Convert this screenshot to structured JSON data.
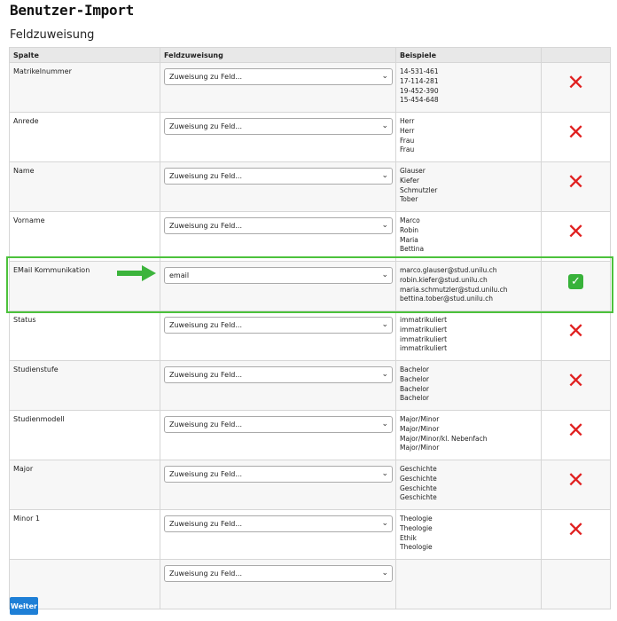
{
  "page": {
    "title": "Benutzer-Import",
    "section_title": "Feldzuweisung"
  },
  "table": {
    "headers": [
      "Spalte",
      "Feldzuweisung",
      "Beispiele",
      ""
    ],
    "rows": [
      {
        "column": "Matrikelnummer",
        "assignment": "Zuweisung zu Feld...",
        "examples": [
          "14-531-461",
          "17-114-281",
          "19-452-390",
          "15-454-648"
        ],
        "status": "invalid"
      },
      {
        "column": "Anrede",
        "assignment": "Zuweisung zu Feld...",
        "examples": [
          "Herr",
          "Herr",
          "Frau",
          "Frau"
        ],
        "status": "invalid"
      },
      {
        "column": "Name",
        "assignment": "Zuweisung zu Feld...",
        "examples": [
          "Glauser",
          "Kiefer",
          "Schmutzler",
          "Tober"
        ],
        "status": "invalid"
      },
      {
        "column": "Vorname",
        "assignment": "Zuweisung zu Feld...",
        "examples": [
          "Marco",
          "Robin",
          "Maria",
          "Bettina"
        ],
        "status": "invalid"
      },
      {
        "column": "EMail Kommunikation",
        "assignment": "email",
        "examples": [
          "marco.glauser@stud.unilu.ch",
          "robin.kiefer@stud.unilu.ch",
          "maria.schmutzler@stud.unilu.ch",
          "bettina.tober@stud.unilu.ch"
        ],
        "status": "valid"
      },
      {
        "column": "Status",
        "assignment": "Zuweisung zu Feld...",
        "examples": [
          "immatrikuliert",
          "immatrikuliert",
          "immatrikuliert",
          "immatrikuliert"
        ],
        "status": "invalid"
      },
      {
        "column": "Studienstufe",
        "assignment": "Zuweisung zu Feld...",
        "examples": [
          "Bachelor",
          "Bachelor",
          "Bachelor",
          "Bachelor"
        ],
        "status": "invalid"
      },
      {
        "column": "Studienmodell",
        "assignment": "Zuweisung zu Feld...",
        "examples": [
          "Major/Minor",
          "Major/Minor",
          "Major/Minor/kl. Nebenfach",
          "Major/Minor"
        ],
        "status": "invalid"
      },
      {
        "column": "Major",
        "assignment": "Zuweisung zu Feld...",
        "examples": [
          "Geschichte",
          "Geschichte",
          "Geschichte",
          "Geschichte"
        ],
        "status": "invalid"
      },
      {
        "column": "Minor 1",
        "assignment": "Zuweisung zu Feld...",
        "examples": [
          "Theologie",
          "Theologie",
          "Ethik",
          "Theologie"
        ],
        "status": "invalid"
      },
      {
        "column": "",
        "assignment": "Zuweisung zu Feld...",
        "examples": [],
        "status": "none"
      }
    ]
  },
  "icons": {
    "invalid": "cross-mark-icon",
    "valid": "check-mark-icon",
    "chevron": "chevron-down-icon",
    "arrow": "arrow-right-icon"
  },
  "colors": {
    "highlight": "#4cc23c",
    "error": "#e02020",
    "success": "#38b23a",
    "button": "#1e7fd6"
  },
  "footer": {
    "next_label": "Weiter"
  }
}
